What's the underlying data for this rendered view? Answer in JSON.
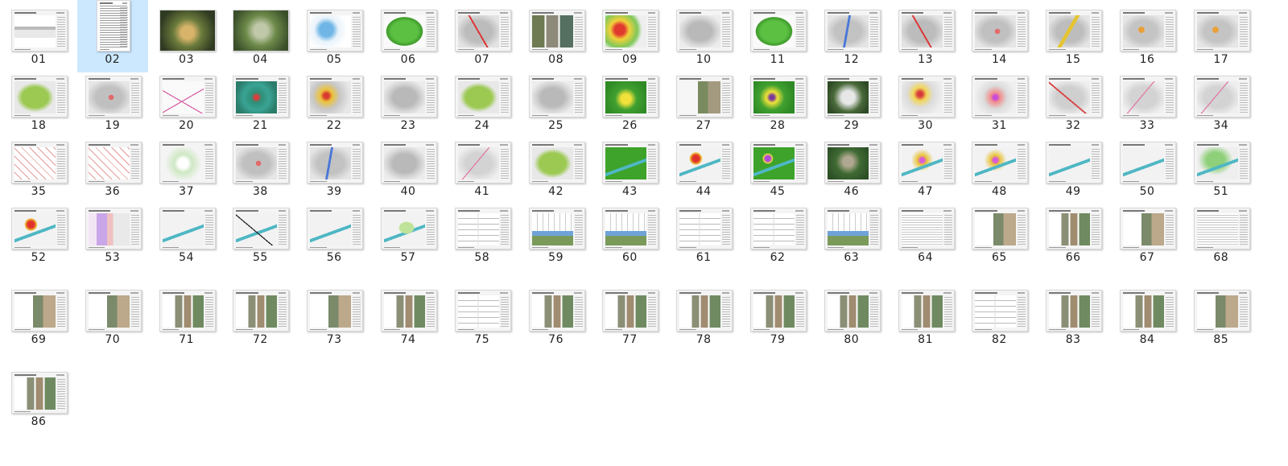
{
  "explorer": {
    "selected_index": 1,
    "items": [
      {
        "label": "01",
        "kind": "k-cover"
      },
      {
        "label": "02",
        "kind": "k-toc",
        "portrait": true
      },
      {
        "label": "03",
        "kind": "k-aerial",
        "photo": true
      },
      {
        "label": "04",
        "kind": "k-aerial2",
        "photo": true
      },
      {
        "label": "05",
        "kind": "k-blue"
      },
      {
        "label": "06",
        "kind": "k-green"
      },
      {
        "label": "07",
        "kind": "k-grayred"
      },
      {
        "label": "08",
        "kind": "k-photos"
      },
      {
        "label": "09",
        "kind": "k-heat"
      },
      {
        "label": "10",
        "kind": "k-gray"
      },
      {
        "label": "11",
        "kind": "k-green"
      },
      {
        "label": "12",
        "kind": "k-grayblue"
      },
      {
        "label": "13",
        "kind": "k-grayred"
      },
      {
        "label": "14",
        "kind": "k-grayrw"
      },
      {
        "label": "15",
        "kind": "k-grayyellow"
      },
      {
        "label": "16",
        "kind": "k-grayorange"
      },
      {
        "label": "17",
        "kind": "k-grayorange"
      },
      {
        "label": "18",
        "kind": "k-lime"
      },
      {
        "label": "19",
        "kind": "k-grayrw"
      },
      {
        "label": "20",
        "kind": "k-pinkline"
      },
      {
        "label": "21",
        "kind": "k-teal"
      },
      {
        "label": "22",
        "kind": "k-gmix"
      },
      {
        "label": "23",
        "kind": "k-gray"
      },
      {
        "label": "24",
        "kind": "k-lime"
      },
      {
        "label": "25",
        "kind": "k-gray"
      },
      {
        "label": "26",
        "kind": "k-gy"
      },
      {
        "label": "27",
        "kind": "k-photosw"
      },
      {
        "label": "28",
        "kind": "k-gyp"
      },
      {
        "label": "29",
        "kind": "k-satellite"
      },
      {
        "label": "30",
        "kind": "k-redyellow"
      },
      {
        "label": "31",
        "kind": "k-pinkmix"
      },
      {
        "label": "32",
        "kind": "k-redgray"
      },
      {
        "label": "33",
        "kind": "k-pinkgray"
      },
      {
        "label": "34",
        "kind": "k-pinkgray"
      },
      {
        "label": "35",
        "kind": "k-redlines"
      },
      {
        "label": "36",
        "kind": "k-redlines"
      },
      {
        "label": "37",
        "kind": "k-greenwhite"
      },
      {
        "label": "38",
        "kind": "k-grayrw"
      },
      {
        "label": "39",
        "kind": "k-grayblue"
      },
      {
        "label": "40",
        "kind": "k-gray"
      },
      {
        "label": "41",
        "kind": "k-pinkgray"
      },
      {
        "label": "42",
        "kind": "k-lime"
      },
      {
        "label": "43",
        "kind": "k-greenriver"
      },
      {
        "label": "44",
        "kind": "k-riverred"
      },
      {
        "label": "45",
        "kind": "k-greenriverp"
      },
      {
        "label": "46",
        "kind": "k-satriver"
      },
      {
        "label": "47",
        "kind": "k-rivermix"
      },
      {
        "label": "48",
        "kind": "k-rivermix"
      },
      {
        "label": "49",
        "kind": "k-river"
      },
      {
        "label": "50",
        "kind": "k-river"
      },
      {
        "label": "51",
        "kind": "k-rivergreen"
      },
      {
        "label": "52",
        "kind": "k-riverred"
      },
      {
        "label": "53",
        "kind": "k-plan"
      },
      {
        "label": "54",
        "kind": "k-riverblue"
      },
      {
        "label": "55",
        "kind": "k-riverblk"
      },
      {
        "label": "56",
        "kind": "k-river"
      },
      {
        "label": "57",
        "kind": "k-riverlg"
      },
      {
        "label": "58",
        "kind": "k-drawing"
      },
      {
        "label": "59",
        "kind": "k-drawphoto"
      },
      {
        "label": "60",
        "kind": "k-drawphoto"
      },
      {
        "label": "61",
        "kind": "k-drawing"
      },
      {
        "label": "62",
        "kind": "k-drawing"
      },
      {
        "label": "63",
        "kind": "k-drawphoto"
      },
      {
        "label": "64",
        "kind": "k-textdoc"
      },
      {
        "label": "65",
        "kind": "k-docphoto"
      },
      {
        "label": "66",
        "kind": "k-docgrid"
      },
      {
        "label": "67",
        "kind": "k-docphoto"
      },
      {
        "label": "68",
        "kind": "k-textdoc"
      },
      {
        "label": "69",
        "kind": "k-docphoto"
      },
      {
        "label": "70",
        "kind": "k-docphoto"
      },
      {
        "label": "71",
        "kind": "k-docgrid"
      },
      {
        "label": "72",
        "kind": "k-docgrid"
      },
      {
        "label": "73",
        "kind": "k-docphoto"
      },
      {
        "label": "74",
        "kind": "k-docgrid"
      },
      {
        "label": "75",
        "kind": "k-drawing"
      },
      {
        "label": "76",
        "kind": "k-docgrid"
      },
      {
        "label": "77",
        "kind": "k-docgrid"
      },
      {
        "label": "78",
        "kind": "k-docgrid"
      },
      {
        "label": "79",
        "kind": "k-docgrid"
      },
      {
        "label": "80",
        "kind": "k-docgrid"
      },
      {
        "label": "81",
        "kind": "k-docgrid"
      },
      {
        "label": "82",
        "kind": "k-drawing"
      },
      {
        "label": "83",
        "kind": "k-docgrid"
      },
      {
        "label": "84",
        "kind": "k-docgrid"
      },
      {
        "label": "85",
        "kind": "k-docphoto"
      },
      {
        "label": "86",
        "kind": "k-docgrid"
      }
    ]
  }
}
